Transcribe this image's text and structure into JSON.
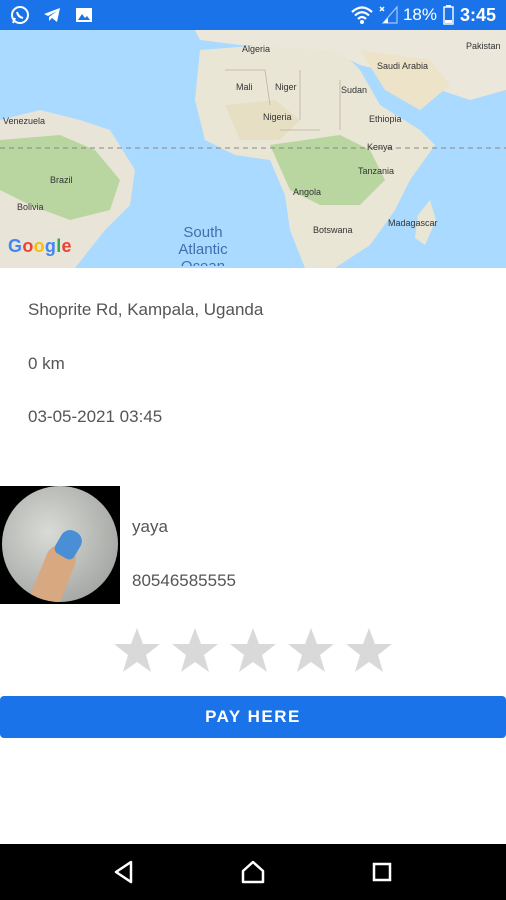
{
  "status_bar": {
    "icons_left": [
      "whatsapp-icon",
      "telegram-icon",
      "gallery-icon"
    ],
    "battery": "18%",
    "time": "3:45"
  },
  "map": {
    "countries": [
      "Algeria",
      "Saudi Arabia",
      "Pakistan",
      "Mali",
      "Niger",
      "Sudan",
      "Nigeria",
      "Ethiopia",
      "Venezuela",
      "Kenya",
      "Tanzania",
      "Brazil",
      "Angola",
      "Bolivia",
      "Botswana",
      "Madagascar"
    ],
    "ocean_label": "South Atlantic Ocean",
    "provider": "Google"
  },
  "ride": {
    "address": "Shoprite Rd, Kampala, Uganda",
    "distance": "0 km",
    "datetime": "03-05-2021 03:45"
  },
  "driver": {
    "name": "yaya",
    "phone": "80546585555"
  },
  "rating": {
    "value": 0,
    "max": 5
  },
  "actions": {
    "pay_label": "PAY HERE"
  },
  "colors": {
    "accent": "#1a73e8",
    "star_empty": "#d9d9d9"
  }
}
